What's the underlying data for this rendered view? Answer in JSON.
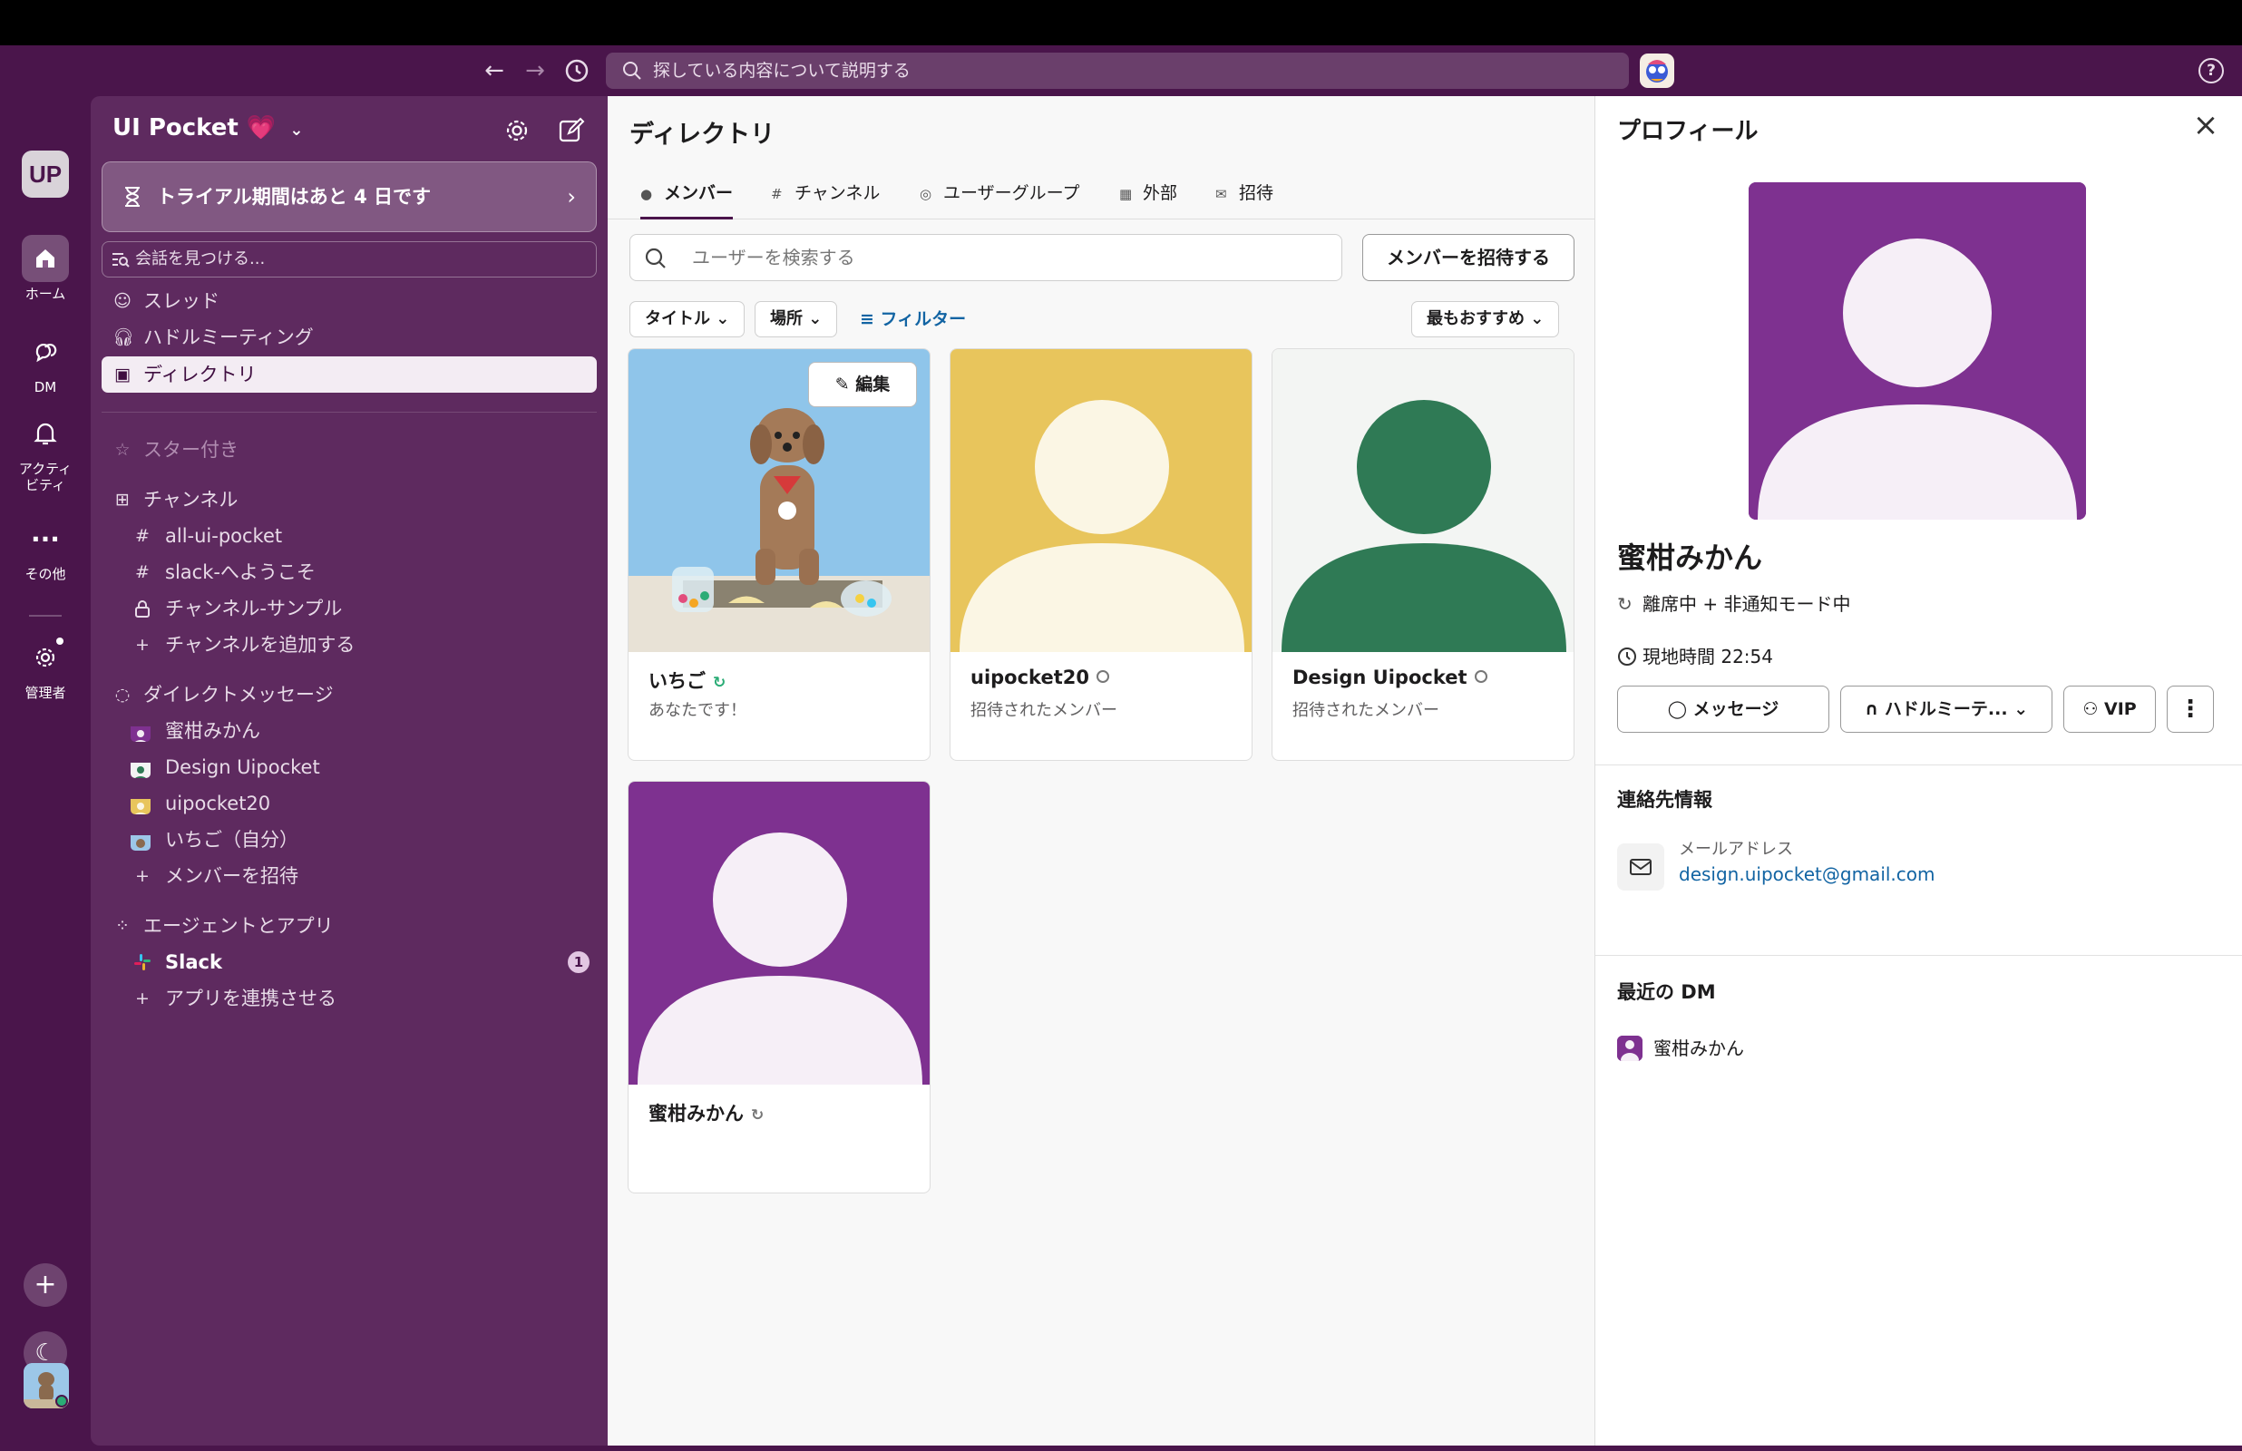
{
  "topbar": {
    "search_placeholder": "探している内容について説明する",
    "back_label": "←",
    "forward_label": "→"
  },
  "rail": {
    "workspace_initials": "UP",
    "items": [
      {
        "label": "ホーム"
      },
      {
        "label": "DM"
      },
      {
        "label": "アクティビティ"
      },
      {
        "label": "その他"
      },
      {
        "label": "管理者"
      }
    ],
    "add_label": "+",
    "theme_label": "☾"
  },
  "sidebar": {
    "workspace_name": "UI Pocket",
    "workspace_heart": "💗",
    "trial_text": "トライアル期間はあと 4 日です",
    "find_conversation": "会話を見つける...",
    "nav": {
      "threads": "スレッド",
      "huddles": "ハドルミーティング",
      "directory": "ディレクトリ"
    },
    "starred": "スター付き",
    "channels_header": "チャンネル",
    "channels": [
      "all-ui-pocket",
      "slack-へようこそ",
      "チャンネル-サンプル"
    ],
    "add_channel": "チャンネルを追加する",
    "dm_header": "ダイレクトメッセージ",
    "dms": [
      "蜜柑みかん",
      "Design Uipocket",
      "uipocket20",
      "いちご（自分）"
    ],
    "invite_members": "メンバーを招待",
    "apps_header": "エージェントとアプリ",
    "apps": [
      {
        "name": "Slack",
        "badge": "1"
      }
    ],
    "connect_apps": "アプリを連携させる"
  },
  "directory": {
    "title": "ディレクトリ",
    "tabs": [
      "メンバー",
      "チャンネル",
      "ユーザーグループ",
      "外部",
      "招待"
    ],
    "search_placeholder": "ユーザーを検索する",
    "invite_button": "メンバーを招待する",
    "filters": {
      "title": "タイトル",
      "location": "場所",
      "filter": "フィルター",
      "sort": "最もおすすめ"
    },
    "members": [
      {
        "name": "いちご",
        "subtitle": "あなたです！",
        "edit": "編集",
        "color": "#8fc5ea"
      },
      {
        "name": "uipocket20",
        "subtitle": "招待されたメンバー",
        "color": "#e8c55c"
      },
      {
        "name": "Design Uipocket",
        "subtitle": "招待されたメンバー",
        "color": "#2f7a55"
      },
      {
        "name": "蜜柑みかん",
        "subtitle": "",
        "color": "#7e3190"
      }
    ]
  },
  "profile": {
    "title": "プロフィール",
    "name": "蜜柑みかん",
    "status": "離席中 + 非通知モード中",
    "local_time": "現地時間 22:54",
    "buttons": {
      "message": "メッセージ",
      "huddle": "ハドルミーテ...",
      "vip": "VIP"
    },
    "contact_header": "連絡先情報",
    "email_label": "メールアドレス",
    "email": "design.uipocket@gmail.com",
    "recent_dm_header": "最近の DM",
    "recent_dm_name": "蜜柑みかん"
  }
}
